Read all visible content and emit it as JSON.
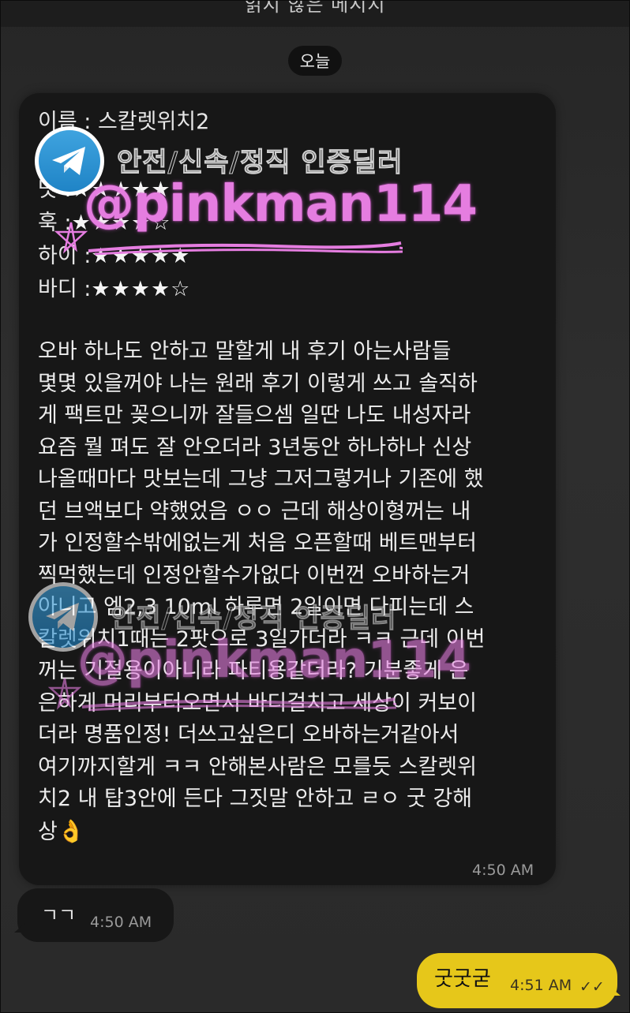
{
  "topbar": {
    "label": "읽지 않은 메시지"
  },
  "date_divider": {
    "label": "오늘"
  },
  "message_main": {
    "name_line": "이름 : 스칼렛위치2",
    "ratings": [
      {
        "label": "맛 : ",
        "stars": "★★★★★"
      },
      {
        "label": "훅 : ",
        "stars": "★★★★☆"
      },
      {
        "label": "하이 : ",
        "stars": "★★★★★"
      },
      {
        "label": "바디 : ",
        "stars": "★★★★☆"
      }
    ],
    "body": "오바 하나도 안하고 말할게 내 후기 아는사람들\n몇몇 있을꺼야 나는 원래 후기 이렇게 쓰고 솔직하\n게 팩트만 꽂으니까 잘들으셈 일딴 나도 내성자라\n요즘 뭘 펴도 잘 안오더라 3년동안 하나하나 신상\n나올때마다 맛보는데 그냥 그저그렇거나 기존에 했\n던 브액보다 약했었음 ㅇㅇ 근데 해상이형꺼는 내\n가 인정할수밖에없는게 처음 오픈할때 베트맨부터\n찍먹했는데 인정안할수가없다 이번껀 오바하는거\n아니고 엠2,3 10ml 하루면 2일이면 다피는데 스\n칼렛위치1때는 2팟으로 3일가더라 ㅋㅋ 근데 이번\n꺼는 기절용이아니라 파티용같더라? 기분좋게 은\n은하게 머리부터오면서 바디걸치고 세상이 커보이\n더라 명품인정! 더쓰고싶은디 오바하는거같아서\n여기까지할게 ㅋㅋ 안해본사람은 모를듯 스칼렛위\n치2 내 탑3안에 든다 그짓말 안하고 ㄹㅇ 굿 강해\n상",
    "emoji": "👌",
    "time": "4:50 AM"
  },
  "message_small": {
    "text": "ㄱㄱ",
    "time": "4:50 AM"
  },
  "message_mine": {
    "text": "굿굿굳",
    "time": "4:51 AM",
    "read_mark": "✓✓"
  },
  "watermark": {
    "tagline": "안전/신속/정직 인증딜러",
    "handle": "@pinkman114",
    "icon": "telegram-icon"
  },
  "colors": {
    "background": "#2a2a2a",
    "bubble_dark": "#171717",
    "bubble_mine": "#e6c71a",
    "watermark_pink": "#e57de0",
    "telegram_blue": "#2a8fd0"
  }
}
